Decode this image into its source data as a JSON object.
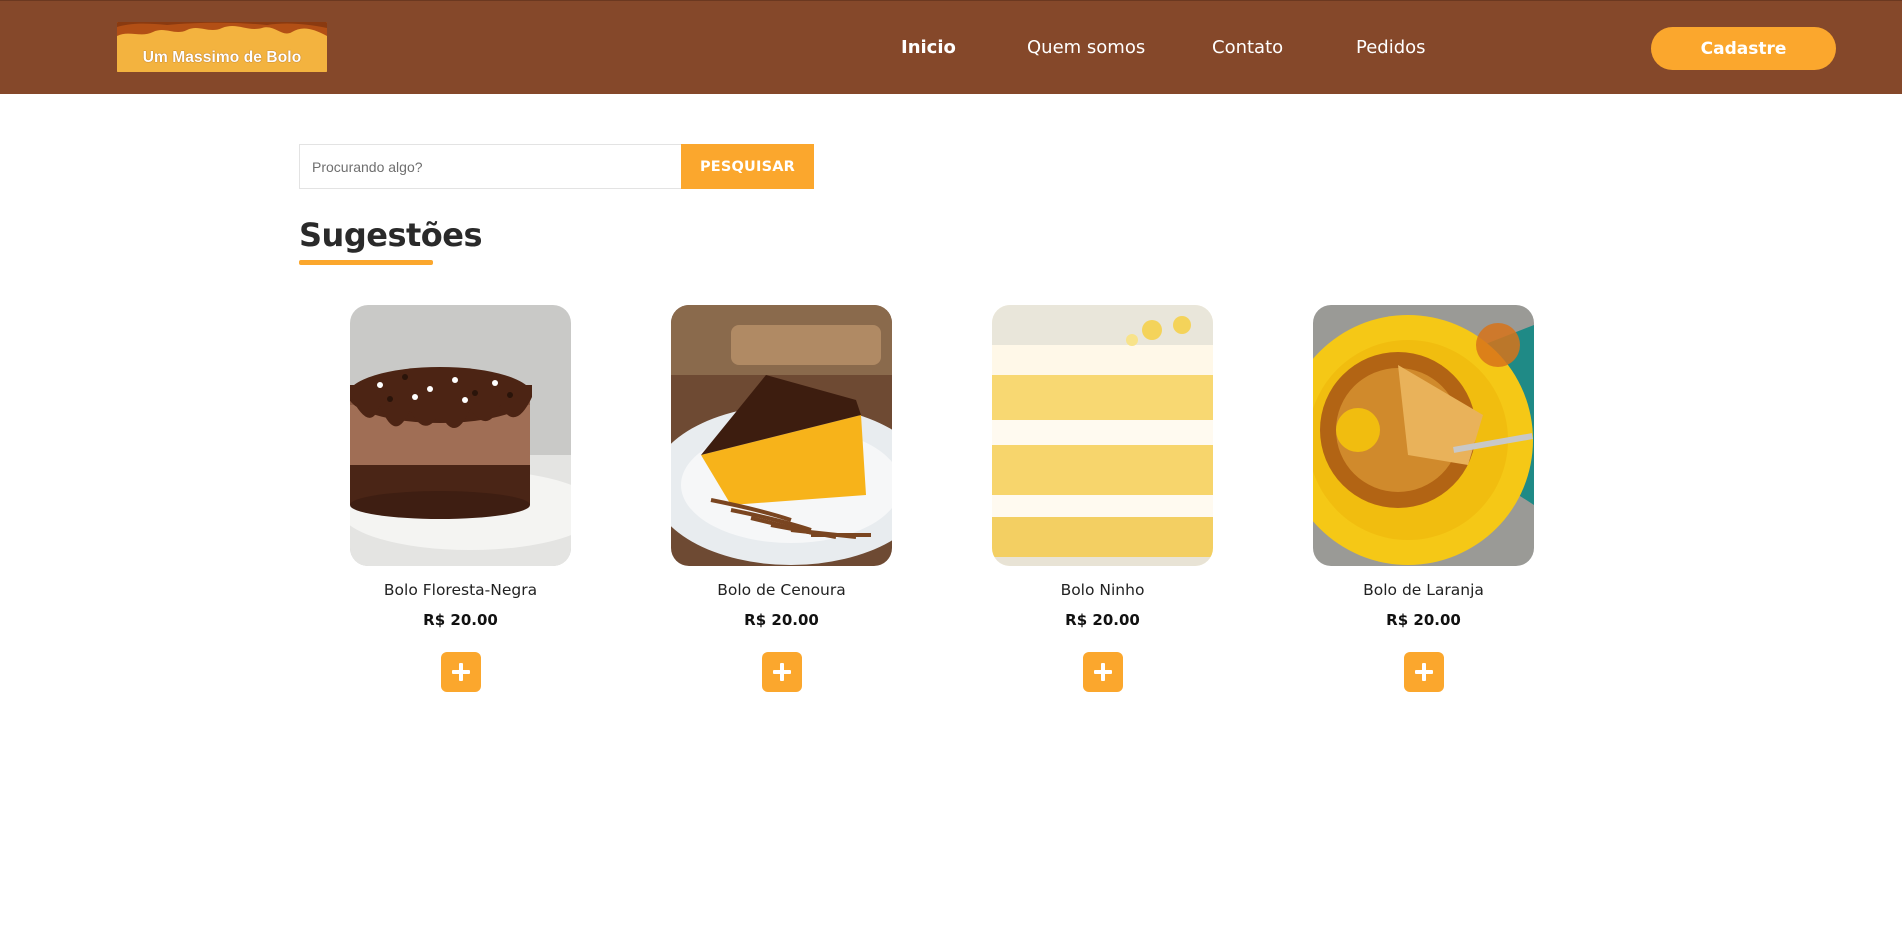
{
  "header": {
    "logo_text": "Um Massimo de Bolo",
    "nav": [
      {
        "label": "Inicio",
        "active": true
      },
      {
        "label": "Quem somos",
        "active": false
      },
      {
        "label": "Contato",
        "active": false
      },
      {
        "label": "Pedidos",
        "active": false
      }
    ],
    "signup_label": "Cadastre"
  },
  "search": {
    "placeholder": "Procurando algo?",
    "value": "",
    "button_label": "PESQUISAR"
  },
  "section": {
    "title": "Sugestões"
  },
  "products": [
    {
      "name": "Bolo Floresta-Negra",
      "price": "R$ 20.00",
      "image_icon": "chocolate-cake-image"
    },
    {
      "name": "Bolo de Cenoura",
      "price": "R$ 20.00",
      "image_icon": "carrot-cake-image"
    },
    {
      "name": "Bolo Ninho",
      "price": "R$ 20.00",
      "image_icon": "ninho-cake-image"
    },
    {
      "name": "Bolo de Laranja",
      "price": "R$ 20.00",
      "image_icon": "orange-cake-image"
    }
  ],
  "colors": {
    "header_bg": "#85482a",
    "accent": "#fba72d",
    "text": "#222222"
  }
}
